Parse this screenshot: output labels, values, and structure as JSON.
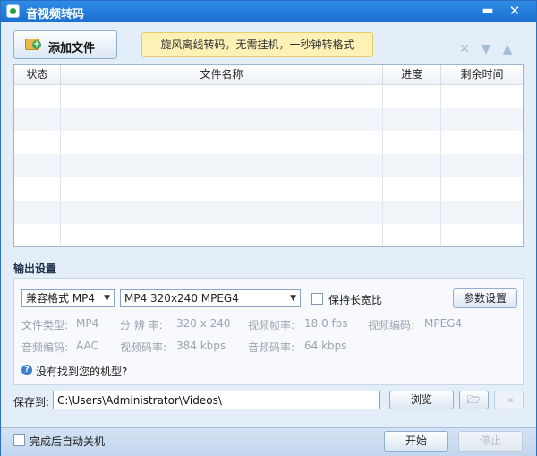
{
  "window": {
    "title": "音视频转码",
    "minimize": "▬",
    "close": "✕"
  },
  "toolbar": {
    "add_files": "添加文件",
    "promo": "旋风离线转码，无需挂机，一秒钟转格式",
    "icons": [
      "delete-icon",
      "move-down-icon",
      "move-up-icon"
    ]
  },
  "table": {
    "columns": [
      "状态",
      "文件名称",
      "进度",
      "剩余时间"
    ],
    "rows": []
  },
  "output": {
    "section_title": "输出设置",
    "format_select": "兼容格式 MP4",
    "preset_select": "MP4 320x240 MPEG4",
    "keep_ratio": {
      "label": "保持长宽比",
      "checked": false
    },
    "param_button": "参数设置",
    "info": {
      "file_type_label": "文件类型:",
      "file_type": "MP4",
      "resolution_label": "分 辨 率:",
      "resolution": "320 x 240",
      "frame_rate_label": "视频帧率:",
      "frame_rate": "18.0 fps",
      "video_codec_label": "视频编码:",
      "video_codec": "MPEG4",
      "audio_codec_label": "音频编码:",
      "audio_codec": "AAC",
      "video_bitrate_label": "视频码率:",
      "video_bitrate": "384 kbps",
      "audio_bitrate_label": "音频码率:",
      "audio_bitrate": "64 kbps"
    },
    "help_link": "没有找到您的机型?"
  },
  "save": {
    "label": "保存到:",
    "path": "C:\\Users\\Administrator\\Videos\\",
    "browse": "浏览"
  },
  "footer": {
    "auto_shutdown": {
      "label": "完成后自动关机",
      "checked": false
    },
    "start": "开始",
    "stop": "停止"
  }
}
